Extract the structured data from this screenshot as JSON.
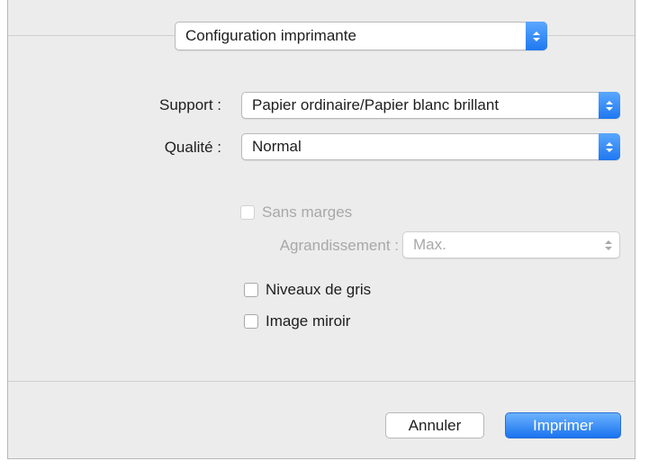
{
  "header": {
    "selector_value": "Configuration imprimante"
  },
  "form": {
    "support_label": "Support :",
    "support_value": "Papier ordinaire/Papier blanc brillant",
    "quality_label": "Qualité :",
    "quality_value": "Normal",
    "borderless_label": "Sans marges",
    "enlargement_label": "Agrandissement :",
    "enlargement_value": "Max.",
    "grayscale_label": "Niveaux de gris",
    "mirror_label": "Image miroir"
  },
  "footer": {
    "cancel_label": "Annuler",
    "print_label": "Imprimer"
  },
  "colors": {
    "accent": "#1f78f0",
    "dialog_bg": "#ececec",
    "disabled_text": "#a8a8a8"
  }
}
